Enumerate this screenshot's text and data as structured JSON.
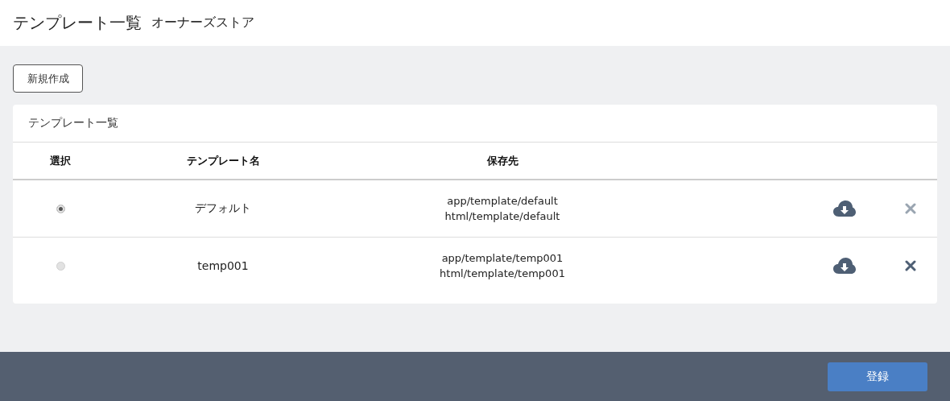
{
  "header": {
    "title": "テンプレート一覧",
    "subtitle": "オーナーズストア"
  },
  "new_button": "新規作成",
  "card": {
    "title": "テンプレート一覧",
    "columns": [
      "選択",
      "テンプレート名",
      "保存先"
    ],
    "rows": [
      {
        "selected": true,
        "name": "デフォルト",
        "paths": [
          "app/template/default",
          "html/template/default"
        ],
        "delete_disabled": true
      },
      {
        "selected": false,
        "name": "temp001",
        "paths": [
          "app/template/temp001",
          "html/template/temp001"
        ],
        "delete_disabled": false
      }
    ]
  },
  "footer": {
    "register_button": "登録"
  }
}
